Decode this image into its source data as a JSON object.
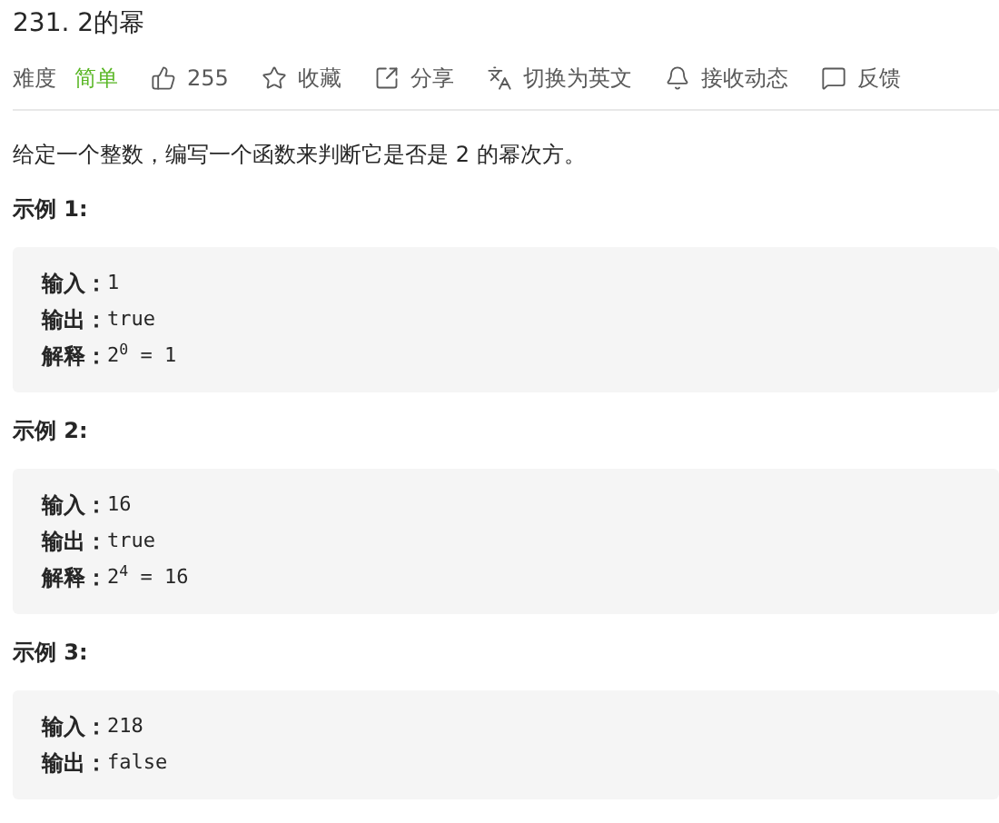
{
  "title": "231. 2的幂",
  "difficulty": {
    "label": "难度",
    "value": "简单"
  },
  "actions": [
    {
      "kind": "like",
      "label": "255"
    },
    {
      "kind": "star",
      "label": "收藏"
    },
    {
      "kind": "share",
      "label": "分享"
    },
    {
      "kind": "translate",
      "label": "切换为英文"
    },
    {
      "kind": "bell",
      "label": "接收动态"
    },
    {
      "kind": "feedback",
      "label": "反馈"
    }
  ],
  "description": "给定一个整数，编写一个函数来判断它是否是 2 的幂次方。",
  "examples": [
    {
      "heading": "示例 1:",
      "lines": [
        {
          "label": "输入：",
          "value": "1"
        },
        {
          "label": "输出：",
          "value": "true"
        },
        {
          "label": "解释：",
          "value": "2$^{0}$ = 1"
        }
      ]
    },
    {
      "heading": "示例 2:",
      "lines": [
        {
          "label": "输入：",
          "value": "16"
        },
        {
          "label": "输出：",
          "value": "true"
        },
        {
          "label": "解释：",
          "value": "2$^{4}$ = 16"
        }
      ]
    },
    {
      "heading": "示例 3:",
      "lines": [
        {
          "label": "输入：",
          "value": "218"
        },
        {
          "label": "输出：",
          "value": "false"
        }
      ]
    }
  ]
}
